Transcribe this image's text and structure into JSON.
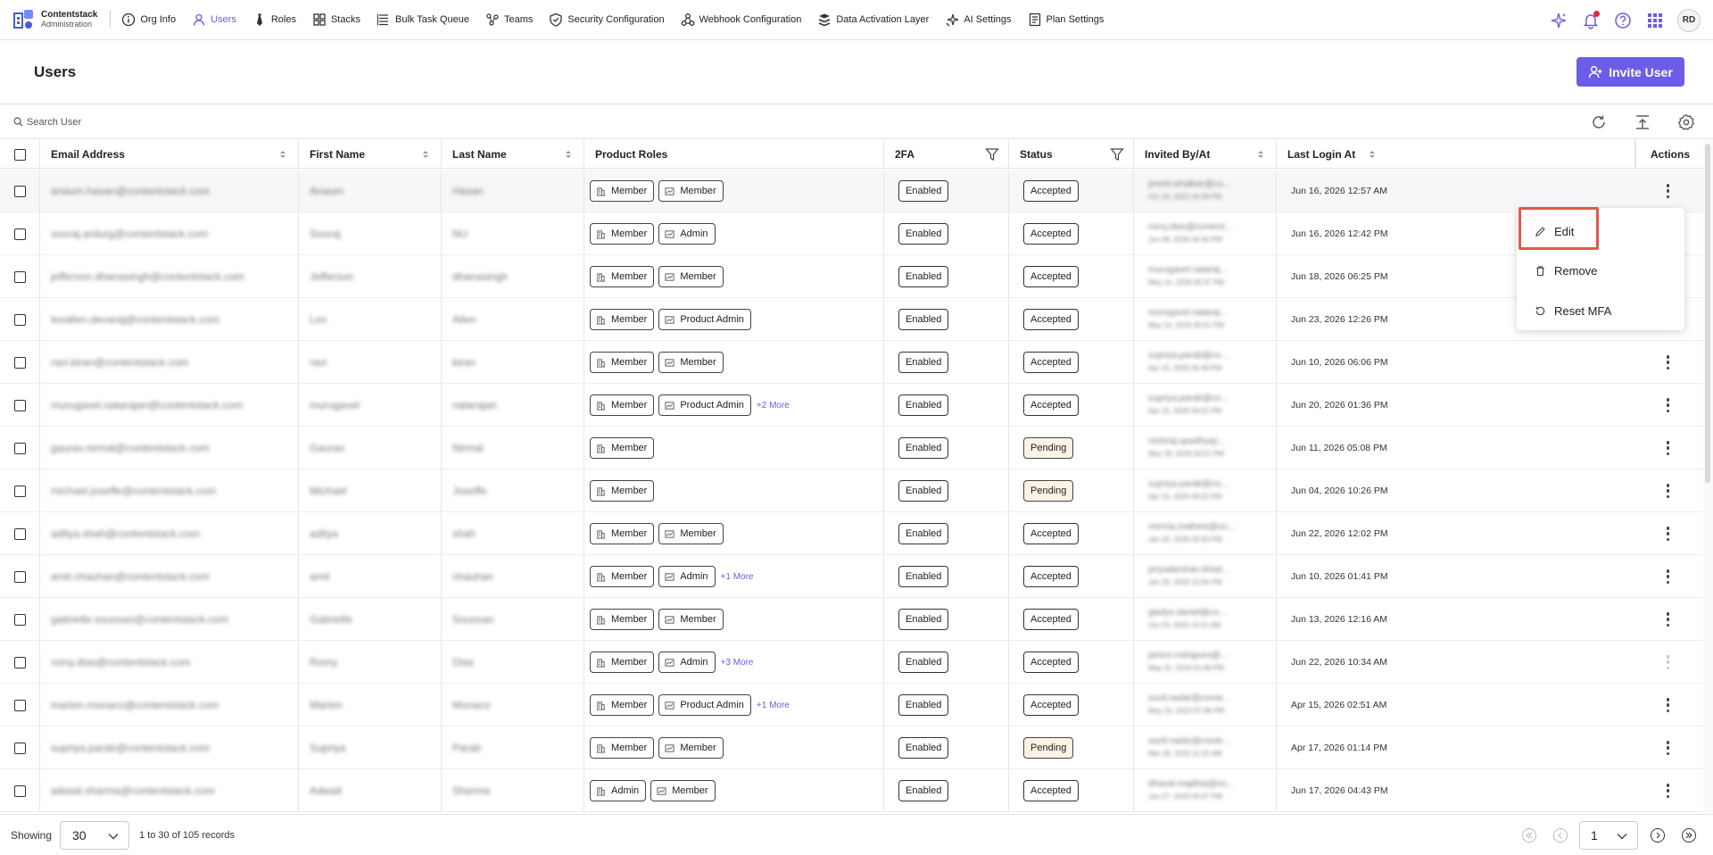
{
  "brand": {
    "name": "Contentstack",
    "sub": "Administration"
  },
  "nav": {
    "items": [
      {
        "label": "Org Info",
        "icon": "info-icon"
      },
      {
        "label": "Users",
        "icon": "user-icon",
        "active": true
      },
      {
        "label": "Roles",
        "icon": "tie-icon"
      },
      {
        "label": "Stacks",
        "icon": "grid-icon"
      },
      {
        "label": "Bulk Task Queue",
        "icon": "list-icon"
      },
      {
        "label": "Teams",
        "icon": "teams-icon"
      },
      {
        "label": "Security Configuration",
        "icon": "shield-icon"
      },
      {
        "label": "Webhook Configuration",
        "icon": "webhook-icon"
      },
      {
        "label": "Data Activation Layer",
        "icon": "layers-icon"
      },
      {
        "label": "AI Settings",
        "icon": "sparkle-icon"
      },
      {
        "label": "Plan Settings",
        "icon": "plan-icon"
      }
    ],
    "avatar": "RD"
  },
  "header": {
    "title": "Users",
    "invite_label": "Invite User"
  },
  "search": {
    "placeholder": "Search User"
  },
  "columns": {
    "email": "Email Address",
    "first": "First Name",
    "last": "Last Name",
    "roles": "Product Roles",
    "twofa": "2FA",
    "status": "Status",
    "invited": "Invited By/At",
    "login": "Last Login At",
    "actions": "Actions"
  },
  "rows": [
    {
      "email": "anaum.hasan@contentstack.com",
      "first": "Anaum",
      "last": "Hasan",
      "roles": [
        "Member",
        "Member"
      ],
      "more": "",
      "twofa": "Enabled",
      "status": "Accepted",
      "invited_by": "preeti.whatkar@co...",
      "invited_at": "Oct 18, 2022 04:28 PM",
      "login": "Jun 16, 2026 12:57 AM"
    },
    {
      "email": "sooraj.ardurg@contentstack.com",
      "first": "Sooraj",
      "last": "NU",
      "roles": [
        "Member",
        "Admin"
      ],
      "more": "",
      "twofa": "Enabled",
      "status": "Accepted",
      "invited_by": "romy.dias@content...",
      "invited_at": "Jun 08, 2026 04:40 PM",
      "login": "Jun 16, 2026 12:42 PM"
    },
    {
      "email": "jefferson.dhanasingh@contentstack.com",
      "first": "Jefferson",
      "last": "dhanasingh",
      "roles": [
        "Member",
        "Member"
      ],
      "more": "",
      "twofa": "Enabled",
      "status": "Accepted",
      "invited_by": "murugavel.nataraj...",
      "invited_at": "May 14, 2026 05:37 PM",
      "login": "Jun 18, 2026 06:25 PM"
    },
    {
      "email": "lexallen.devaraj@contentstack.com",
      "first": "Lex",
      "last": "Allen",
      "roles": [
        "Member",
        "Product Admin"
      ],
      "more": "",
      "twofa": "Enabled",
      "status": "Accepted",
      "invited_by": "murugavel.nataraj...",
      "invited_at": "May 14, 2026 05:51 PM",
      "login": "Jun 23, 2026 12:26 PM"
    },
    {
      "email": "ravi.kiran@contentstack.com",
      "first": "ravi",
      "last": "kiran",
      "roles": [
        "Member",
        "Member"
      ],
      "more": "",
      "twofa": "Enabled",
      "status": "Accepted",
      "invited_by": "supriya.parab@co...",
      "invited_at": "Apr 15, 2026 05:49 PM",
      "login": "Jun 10, 2026 06:06 PM"
    },
    {
      "email": "murugavel.natarajan@contentstack.com",
      "first": "murugavel",
      "last": "natarajan",
      "roles": [
        "Member",
        "Product Admin"
      ],
      "more": "+2 More",
      "twofa": "Enabled",
      "status": "Accepted",
      "invited_by": "supriya.parab@co...",
      "invited_at": "Apr 15, 2026 04:22 PM",
      "login": "Jun 20, 2026 01:36 PM"
    },
    {
      "email": "gaurav.nirmal@contentstack.com",
      "first": "Gaurav",
      "last": "Nirmal",
      "roles": [
        "Member"
      ],
      "more": "",
      "twofa": "Enabled",
      "status": "Pending",
      "invited_by": "nishiraj.upadhyay...",
      "invited_at": "May 19, 2026 04:51 PM",
      "login": "Jun 11, 2026 05:08 PM"
    },
    {
      "email": "michael.joseffe@contentstack.com",
      "first": "Michael",
      "last": "Joseffe",
      "roles": [
        "Member"
      ],
      "more": "",
      "twofa": "Enabled",
      "status": "Pending",
      "invited_by": "supriya.parab@co...",
      "invited_at": "Apr 15, 2026 06:02 PM",
      "login": "Jun 04, 2026 10:26 PM"
    },
    {
      "email": "aditya.shah@contentstack.com",
      "first": "aditya",
      "last": "shah",
      "roles": [
        "Member",
        "Member"
      ],
      "more": "",
      "twofa": "Enabled",
      "status": "Accepted",
      "invited_by": "mercia.mathew@co...",
      "invited_at": "Jan 20, 2026 05:00 PM",
      "login": "Jun 22, 2026 12:02 PM"
    },
    {
      "email": "amit.chauhan@contentstack.com",
      "first": "amit",
      "last": "chauhan",
      "roles": [
        "Member",
        "Admin"
      ],
      "more": "+1 More",
      "twofa": "Enabled",
      "status": "Accepted",
      "invited_by": "priyadarshan.khad...",
      "invited_at": "Jan 20, 2026 12:54 PM",
      "login": "Jun 10, 2026 01:41 PM"
    },
    {
      "email": "gabrielle.soussan@contentstack.com",
      "first": "Gabrielle",
      "last": "Soussan",
      "roles": [
        "Member",
        "Member"
      ],
      "more": "",
      "twofa": "Enabled",
      "status": "Accepted",
      "invited_by": "gladys.daniel@co...",
      "invited_at": "Oct 23, 2025 10:11 AM",
      "login": "Jun 13, 2026 12:16 AM"
    },
    {
      "email": "romy.dias@contentstack.com",
      "first": "Romy",
      "last": "Dias",
      "roles": [
        "Member",
        "Admin"
      ],
      "more": "+3 More",
      "twofa": "Enabled",
      "status": "Accepted",
      "invited_by": "janice.rodrigues@...",
      "invited_at": "May 31, 2024 01:06 PM",
      "login": "Jun 22, 2026 10:34 AM"
    },
    {
      "email": "marlen.monaco@contentstack.com",
      "first": "Marlen",
      "last": "Monaco",
      "roles": [
        "Member",
        "Product Admin"
      ],
      "more": "+1 More",
      "twofa": "Enabled",
      "status": "Accepted",
      "invited_by": "sunil.nadar@conte...",
      "invited_at": "May 23, 2023 07:08 PM",
      "login": "Apr 15, 2026 02:51 AM"
    },
    {
      "email": "supriya.parab@contentstack.com",
      "first": "Supriya",
      "last": "Parab",
      "roles": [
        "Member",
        "Member"
      ],
      "more": "",
      "twofa": "Enabled",
      "status": "Pending",
      "invited_by": "sunil.nadar@conte...",
      "invited_at": "Mar 28, 2023 11:25 AM",
      "login": "Apr 17, 2026 01:14 PM"
    },
    {
      "email": "adwait.sharma@contentstack.com",
      "first": "Adwait",
      "last": "Sharma",
      "roles": [
        "Admin",
        "Member"
      ],
      "more": "",
      "twofa": "Enabled",
      "status": "Accepted",
      "invited_by": "dhaval.majithia@co...",
      "invited_at": "Jun 27, 2023 05:07 PM",
      "login": "Jun 17, 2026 04:43 PM"
    }
  ],
  "menu": {
    "edit": "Edit",
    "remove": "Remove",
    "reset": "Reset MFA"
  },
  "footer": {
    "showing": "Showing",
    "per_page": "30",
    "records": "1 to 30 of 105 records",
    "page": "1"
  },
  "colors": {
    "accent": "#6c5ce7",
    "pending_bg": "#fdf3e4",
    "highlight": "#e0584a"
  }
}
